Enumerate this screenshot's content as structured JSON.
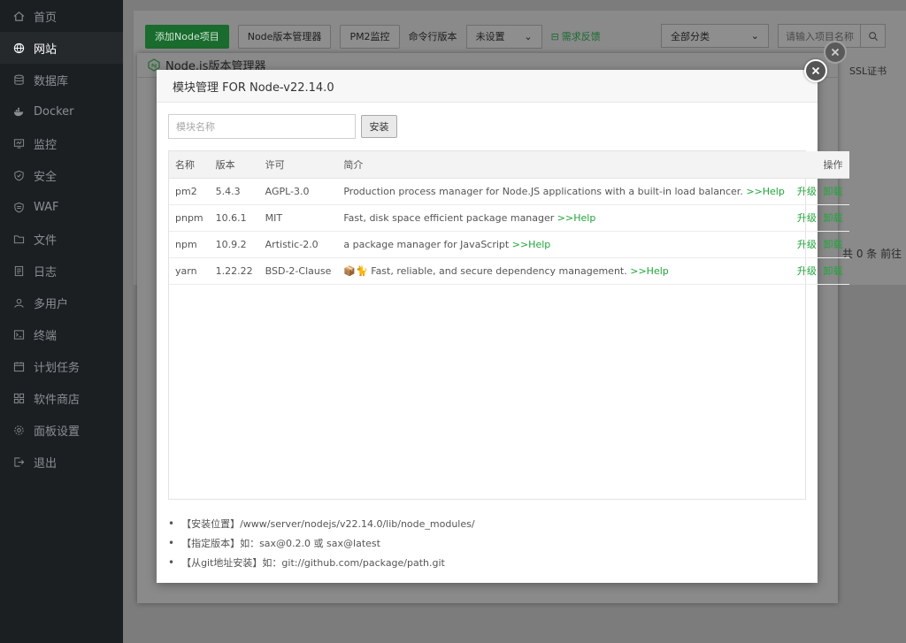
{
  "sidebar": {
    "items": [
      {
        "label": "首页",
        "icon": "home-icon",
        "active": false
      },
      {
        "label": "网站",
        "icon": "globe-icon",
        "active": true
      },
      {
        "label": "数据库",
        "icon": "database-icon",
        "active": false
      },
      {
        "label": "Docker",
        "icon": "docker-icon",
        "active": false
      },
      {
        "label": "监控",
        "icon": "monitor-icon",
        "active": false
      },
      {
        "label": "安全",
        "icon": "shield-icon",
        "active": false
      },
      {
        "label": "WAF",
        "icon": "waf-shield-icon",
        "active": false
      },
      {
        "label": "文件",
        "icon": "folder-icon",
        "active": false
      },
      {
        "label": "日志",
        "icon": "log-icon",
        "active": false
      },
      {
        "label": "多用户",
        "icon": "users-icon",
        "active": false
      },
      {
        "label": "终端",
        "icon": "terminal-icon",
        "active": false
      },
      {
        "label": "计划任务",
        "icon": "calendar-icon",
        "active": false
      },
      {
        "label": "软件商店",
        "icon": "store-icon",
        "active": false
      },
      {
        "label": "面板设置",
        "icon": "gear-icon",
        "active": false
      },
      {
        "label": "退出",
        "icon": "logout-icon",
        "active": false
      }
    ]
  },
  "toolbar": {
    "add_node_project": "添加Node项目",
    "node_version_manager": "Node版本管理器",
    "pm2_monitor": "PM2监控",
    "cli_version_label": "命令行版本",
    "cli_version_value": "未设置",
    "feedback": "需求反馈",
    "category": "全部分类",
    "search_placeholder": "请输入项目名称"
  },
  "background": {
    "ssl_header": "SSL证书",
    "pager": "共 0 条  前往"
  },
  "outer_dialog": {
    "title": "Node.js版本管理器"
  },
  "modal": {
    "title": "模块管理 FOR Node-v22.14.0",
    "search_placeholder": "模块名称",
    "install_label": "安装",
    "columns": {
      "name": "名称",
      "version": "版本",
      "license": "许可",
      "desc": "简介",
      "ops": "操作"
    },
    "rows": [
      {
        "name": "pm2",
        "version": "5.4.3",
        "license": "AGPL-3.0",
        "desc": "Production process manager for Node.JS applications with a built-in load balancer.",
        "help": ">>Help",
        "upgrade": "升级",
        "uninstall": "卸载"
      },
      {
        "name": "pnpm",
        "version": "10.6.1",
        "license": "MIT",
        "desc": "Fast, disk space efficient package manager",
        "help": ">>Help",
        "upgrade": "升级",
        "uninstall": "卸载"
      },
      {
        "name": "npm",
        "version": "10.9.2",
        "license": "Artistic-2.0",
        "desc": "a package manager for JavaScript",
        "help": ">>Help",
        "upgrade": "升级",
        "uninstall": "卸载"
      },
      {
        "name": "yarn",
        "version": "1.22.22",
        "license": "BSD-2-Clause",
        "desc": "📦🐈 Fast, reliable, and secure dependency management.",
        "help": ">>Help",
        "upgrade": "升级",
        "uninstall": "卸载"
      }
    ],
    "tips": [
      "【安装位置】/www/server/nodejs/v22.14.0/lib/node_modules/",
      "【指定版本】如：sax@0.2.0 或 sax@latest",
      "【从git地址安装】如：git://github.com/package/path.git"
    ]
  },
  "colors": {
    "accent": "#20a53a",
    "sidebar_bg": "#1c1f22"
  }
}
